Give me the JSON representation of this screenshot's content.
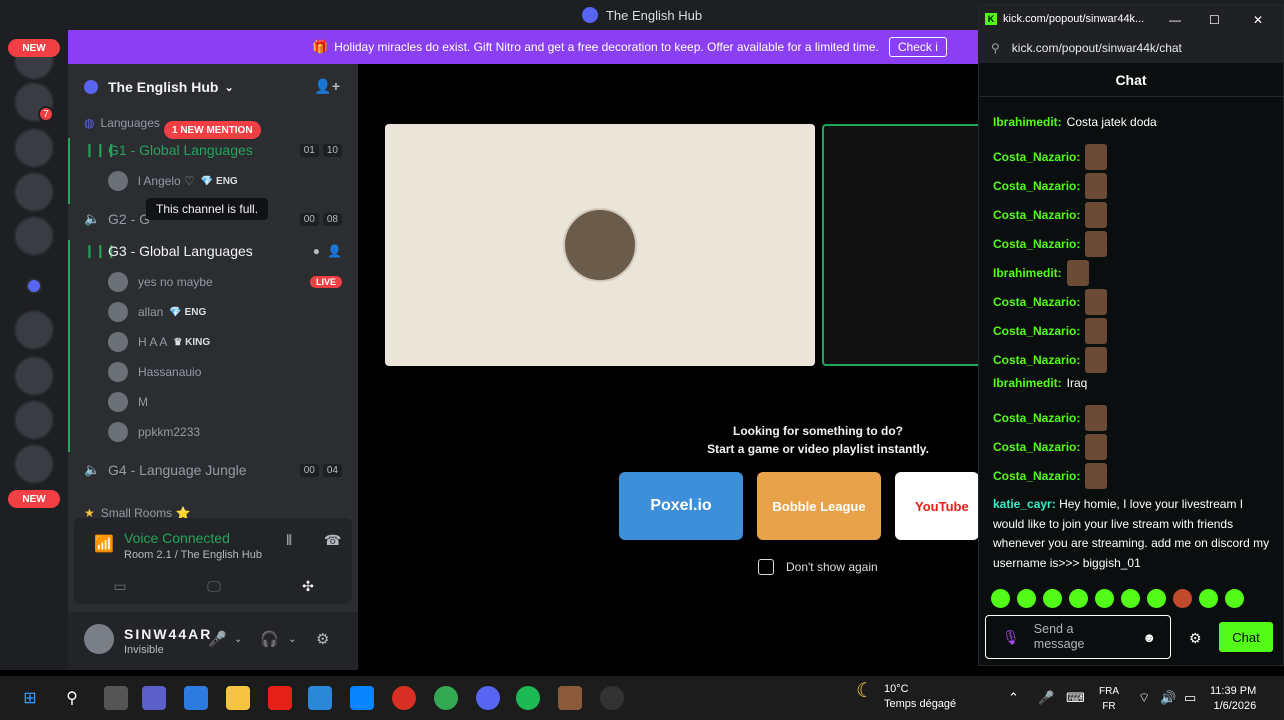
{
  "window": {
    "title": "The English Hub"
  },
  "rail": {
    "new_badge_top": "NEW",
    "new_badge_bottom": "NEW",
    "unread_count": "7"
  },
  "banner": {
    "text": "Holiday miracles do exist. Gift Nitro and get a free decoration to keep. Offer available for a limited time.",
    "button": "Check i"
  },
  "server": {
    "name": "The English Hub"
  },
  "sidebar": {
    "category_languages": "Languages",
    "mention_badge": "1 NEW MENTION",
    "channels": [
      {
        "name": "G1 - Global Languages",
        "count_a": "01",
        "count_b": "10"
      },
      {
        "name": "G2 - G",
        "count_a": "00",
        "count_b": "08"
      },
      {
        "name": "G3 - Global Languages"
      },
      {
        "name": "G4 - Language Jungle",
        "count_a": "00",
        "count_b": "04"
      }
    ],
    "g1_users": [
      {
        "name": "l Angelo ♡",
        "tag": "ENG"
      }
    ],
    "g3_users": [
      {
        "name": "yes no maybe",
        "badge": "LIVE"
      },
      {
        "name": "allan",
        "tag": "ENG"
      },
      {
        "name": "H A A",
        "tag": "KING"
      },
      {
        "name": "Hassanauio"
      },
      {
        "name": "M"
      },
      {
        "name": "ppkkm2233"
      }
    ],
    "tooltip": "This channel is full.",
    "category_small_rooms": "Small Rooms ⭐"
  },
  "voice": {
    "status": "Voice Connected",
    "room": "Room 2.1 / The English Hub"
  },
  "user": {
    "name": "SINW44AR",
    "status": "Invisible"
  },
  "activity": {
    "line1": "Looking for something to do?",
    "line2": "Start a game or video playlist instantly.",
    "games": [
      "Poxel.io",
      "Bobble League",
      "YouTube"
    ],
    "dont_show": "Don't show again"
  },
  "kick": {
    "tab_title": "kick.com/popout/sinwar44k...",
    "url": "kick.com/popout/sinwar44k/chat",
    "header": "Chat",
    "messages": [
      {
        "user": "Ibrahimedit:",
        "text": "Costa jatek doda",
        "color": "g"
      },
      {
        "user": "Costa_Nazario:",
        "text": "",
        "color": "g"
      },
      {
        "user": "Costa_Nazario:",
        "text": "",
        "color": "g"
      },
      {
        "user": "Costa_Nazario:",
        "text": "",
        "color": "g"
      },
      {
        "user": "Costa_Nazario:",
        "text": "",
        "color": "g"
      },
      {
        "user": "Ibrahimedit:",
        "text": "",
        "color": "g"
      },
      {
        "user": "Costa_Nazario:",
        "text": "",
        "color": "g"
      },
      {
        "user": "Costa_Nazario:",
        "text": "",
        "color": "g"
      },
      {
        "user": "Costa_Nazario:",
        "text": "",
        "color": "g"
      },
      {
        "user": "Ibrahimedit:",
        "text": "Iraq",
        "color": "g"
      },
      {
        "user": "Costa_Nazario:",
        "text": "",
        "color": "g"
      },
      {
        "user": "Costa_Nazario:",
        "text": "",
        "color": "g"
      },
      {
        "user": "Costa_Nazario:",
        "text": "",
        "color": "g"
      }
    ],
    "long_user": "katie_cayr:",
    "long_text": "Hey homie, I love your livestream I would like to join your live stream with friends whenever you are streaming. add me on discord my username is>>> biggish_01",
    "placeholder": "Send a message",
    "chat_button": "Chat"
  },
  "taskbar": {
    "temp": "10°C",
    "weather": "Temps dégagé",
    "lang1": "FRA",
    "lang2": "FR",
    "time": "11:39 PM",
    "date": "1/6/2026"
  }
}
